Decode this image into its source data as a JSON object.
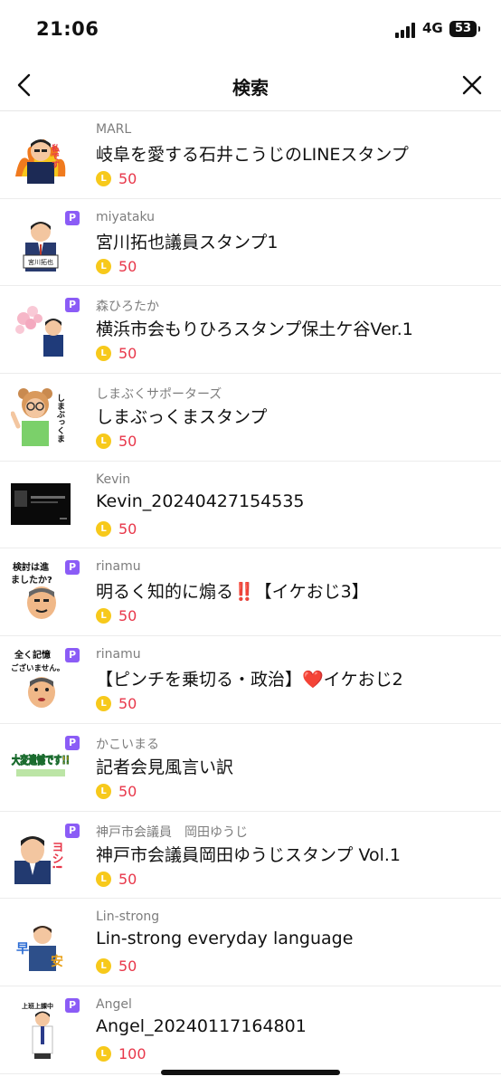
{
  "status_bar": {
    "time": "21:06",
    "network": "4G",
    "battery": "53"
  },
  "nav": {
    "title": "検索",
    "back_icon": "chevron-left-icon",
    "close_icon": "close-icon"
  },
  "coin_glyph": "L",
  "premium_glyph": "P",
  "items": [
    {
      "author": "MARL",
      "title": "岐阜を愛する石井こうじのLINEスタンプ",
      "price": "50",
      "premium": false
    },
    {
      "author": "miyataku",
      "title": "宮川拓也議員スタンプ1",
      "price": "50",
      "premium": true
    },
    {
      "author": "森ひろたか",
      "title": "横浜市会もりひろスタンプ保土ケ谷Ver.1",
      "price": "50",
      "premium": true
    },
    {
      "author": "しまぶくサポーターズ",
      "title": "しまぶっくまスタンプ",
      "price": "50",
      "premium": false
    },
    {
      "author": "Kevin",
      "title": "Kevin_20240427154535",
      "price": "50",
      "premium": false
    },
    {
      "author": "rinamu",
      "title": "明るく知的に煽る‼️【イケおじ3】",
      "price": "50",
      "premium": true
    },
    {
      "author": "rinamu",
      "title": "【ピンチを乗切る・政治】❤️イケおじ2",
      "price": "50",
      "premium": true
    },
    {
      "author": "かこいまる",
      "title": "記者会見風言い訳",
      "price": "50",
      "premium": true
    },
    {
      "author": "神戸市会議員　岡田ゆうじ",
      "title": "神戸市会議員岡田ゆうじスタンプ Vol.1",
      "price": "50",
      "premium": true
    },
    {
      "author": "Lin-strong",
      "title": "Lin-strong everyday language",
      "price": "50",
      "premium": false
    },
    {
      "author": "Angel",
      "title": "Angel_20240117164801",
      "price": "100",
      "premium": true
    }
  ],
  "thumb_text": {
    "t0": "私です",
    "t1": "宮川拓也",
    "t3": "しまぶっくま",
    "t5a": "検討は進",
    "t5b": "ましたか?",
    "t6a": "全く記憶",
    "t6b": "ございません。",
    "t7": "大変遺憾です!!",
    "t8": "ヨシ!",
    "t9a": "早",
    "t9b": "安",
    "t10": "上班上課中"
  },
  "colors": {
    "price": "#e8374a",
    "coin": "#f7c91b",
    "premium": "#8b5cf6",
    "author": "#7d7d7d"
  }
}
